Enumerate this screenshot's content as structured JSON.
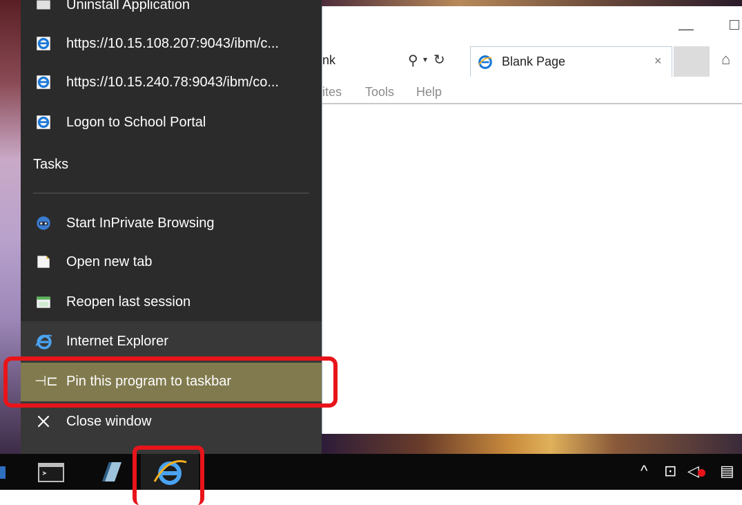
{
  "jumplist": {
    "top_item_partial": "Uninstall Application",
    "recent": [
      {
        "label": "https://10.15.108.207:9043/ibm/c...",
        "icon": "ie-page-icon"
      },
      {
        "label": "https://10.15.240.78:9043/ibm/co...",
        "icon": "ie-page-icon"
      },
      {
        "label": "Logon to School Portal",
        "icon": "ie-page-icon"
      }
    ],
    "tasks_header": "Tasks",
    "tasks": [
      {
        "label": "Start InPrivate Browsing",
        "icon": "inprivate-icon"
      },
      {
        "label": "Open new tab",
        "icon": "new-tab-icon"
      },
      {
        "label": "Reopen last session",
        "icon": "reopen-session-icon"
      }
    ],
    "app": {
      "label": "Internet Explorer",
      "icon": "internet-explorer-icon"
    },
    "pin": {
      "label": "Pin this program to taskbar",
      "icon": "pin-icon"
    },
    "close": {
      "label": "Close window",
      "icon": "close-icon"
    }
  },
  "browser": {
    "address_partial": "nk",
    "tab_title": "Blank Page",
    "tab_close": "×",
    "menu": [
      "ites",
      "Tools",
      "Help"
    ]
  },
  "colors": {
    "jumplist_bg": "#2b2b2b",
    "highlight": "#807a4e",
    "annotation_red": "#e8141a",
    "taskbar_bg": "#0a0a0a"
  }
}
